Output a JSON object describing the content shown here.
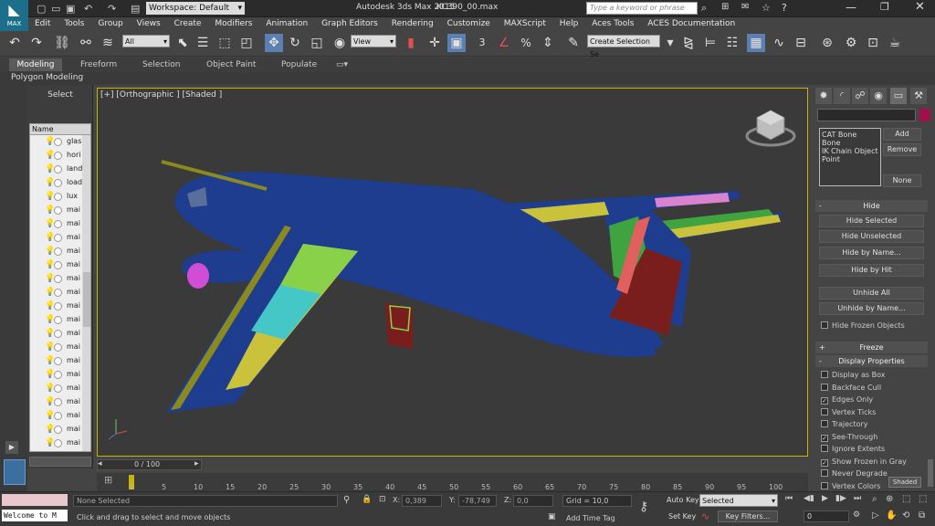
{
  "app": {
    "logo": "MAX",
    "workspace": "Workspace: Default",
    "title": "Autodesk 3ds Max  2015",
    "filename": "KC390_00.max",
    "search_placeholder": "Type a keyword or phrase"
  },
  "menu": [
    "Edit",
    "Tools",
    "Group",
    "Views",
    "Create",
    "Modifiers",
    "Animation",
    "Graph Editors",
    "Rendering",
    "Customize",
    "MAXScript",
    "Help",
    "Aces Tools",
    "ACES Documentation"
  ],
  "toolbar": {
    "filter": "All",
    "view": "View",
    "snap3": "3",
    "angle": "%",
    "selection_set": "Create Selection Se"
  },
  "ribbon": {
    "tabs": [
      "Modeling",
      "Freeform",
      "Selection",
      "Object Paint",
      "Populate"
    ],
    "sub": "Polygon Modeling"
  },
  "scene": {
    "title": "Select",
    "column": "Name",
    "items": [
      "glas",
      "hori",
      "land",
      "load",
      "lux",
      "mai",
      "mai",
      "mai",
      "mai",
      "mai",
      "mai",
      "mai",
      "mai",
      "mai",
      "mai",
      "mai",
      "mai",
      "mai",
      "mai",
      "mai",
      "mai",
      "mai",
      "mai",
      "mai"
    ]
  },
  "viewport": {
    "label": "[+] [Orthographic ] [Shaded ]"
  },
  "panel": {
    "list": [
      "CAT Bone",
      "Bone",
      "IK Chain Object",
      "Point"
    ],
    "add": "Add",
    "remove": "Remove",
    "none": "None",
    "hide_header": "Hide",
    "hide_buttons": [
      "Hide Selected",
      "Hide Unselected",
      "Hide by Name...",
      "Hide by Hit",
      "Unhide All",
      "Unhide by Name..."
    ],
    "hide_frozen": "Hide Frozen Objects",
    "freeze_header": "Freeze",
    "display_header": "Display Properties",
    "display_opts": [
      {
        "label": "Display as Box",
        "checked": false
      },
      {
        "label": "Backface Cull",
        "checked": false
      },
      {
        "label": "Edges Only",
        "checked": true
      },
      {
        "label": "Vertex Ticks",
        "checked": false
      },
      {
        "label": "Trajectory",
        "checked": false
      },
      {
        "label": "See-Through",
        "checked": true
      },
      {
        "label": "Ignore Extents",
        "checked": false
      },
      {
        "label": "Show Frozen in Gray",
        "checked": true
      },
      {
        "label": "Never Degrade",
        "checked": false
      },
      {
        "label": "Vertex Colors",
        "checked": false
      }
    ],
    "shaded": "Shaded"
  },
  "timeline": {
    "frame": "0 / 100",
    "ticks": [
      "0",
      "5",
      "10",
      "15",
      "20",
      "25",
      "30",
      "35",
      "40",
      "45",
      "50",
      "55",
      "60",
      "65",
      "70",
      "75",
      "80",
      "85",
      "90",
      "95",
      "100"
    ]
  },
  "status": {
    "welcome": "Welcome to M",
    "selected": "None Selected",
    "prompt": "Click and drag to select and move objects",
    "x": "0,389",
    "y": "-78,749",
    "z": "0,0",
    "grid": "Grid = 10,0",
    "add_time_tag": "Add Time Tag",
    "auto_key": "Auto Key",
    "set_key": "Set Key",
    "key_mode": "Selected",
    "key_filters": "Key Filters...",
    "frame_field": "0",
    "x_label": "X:",
    "y_label": "Y:",
    "z_label": "Z:"
  },
  "colors": {
    "fuselage": "#1e3d8f",
    "wing_green": "#8ad14a",
    "wing_yellow": "#c9c23a",
    "wing_red": "#e06060",
    "tail_green": "#3fa33f",
    "tail_red": "#7a1d1d",
    "highlight_magenta": "#d04dd6",
    "viewport_border": "#c8b400"
  }
}
